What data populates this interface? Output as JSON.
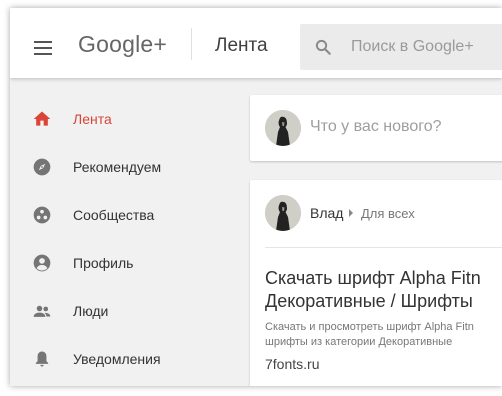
{
  "header": {
    "logo": "Google+",
    "page_title": "Лента",
    "search_placeholder": "Поиск в Google+"
  },
  "sidebar": {
    "items": [
      {
        "label": "Лента",
        "icon": "home-icon",
        "active": true
      },
      {
        "label": "Рекомендуем",
        "icon": "compass-icon"
      },
      {
        "label": "Сообщества",
        "icon": "communities-icon"
      },
      {
        "label": "Профиль",
        "icon": "profile-icon"
      },
      {
        "label": "Люди",
        "icon": "people-icon"
      },
      {
        "label": "Уведомления",
        "icon": "bell-icon"
      }
    ]
  },
  "compose": {
    "placeholder": "Что у вас нового?"
  },
  "post": {
    "author": "Влад",
    "visibility": "Для всех",
    "link": {
      "title_line1": "Скачать шрифт Alpha Fitn",
      "title_line2": "Декоративные / Шрифты",
      "desc_line1": "Скачать и просмотреть шрифт Alpha Fitn",
      "desc_line2": "шрифты из категории Декоративные",
      "domain": "7fonts.ru"
    }
  },
  "colors": {
    "accent": "#db4437",
    "icon_gray": "#757575",
    "background": "#f1f1f1"
  }
}
